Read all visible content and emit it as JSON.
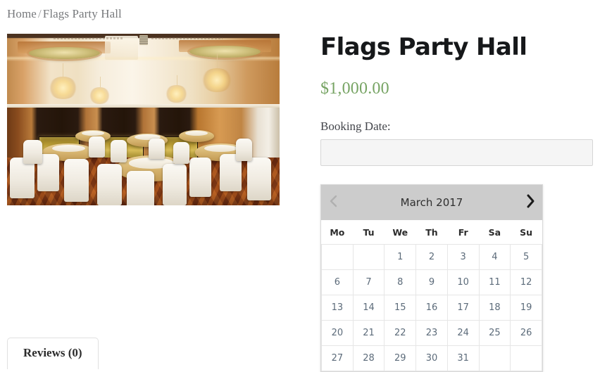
{
  "breadcrumb": {
    "home_label": "Home",
    "separator": "/",
    "current_label": "Flags Party Hall"
  },
  "product": {
    "title": "Flags Party Hall",
    "price": "$1,000.00",
    "image_alt": "Flags Party Hall banquet ballroom with round tables and chandeliers"
  },
  "booking": {
    "field_label": "Booking Date:",
    "input_value": "",
    "input_placeholder": ""
  },
  "datepicker": {
    "month_title": "March 2017",
    "prev_icon": "chevron-left-icon",
    "next_icon": "chevron-right-icon",
    "weekdays": [
      "Mo",
      "Tu",
      "We",
      "Th",
      "Fr",
      "Sa",
      "Su"
    ],
    "weeks": [
      [
        {
          "label": "",
          "state": "empty"
        },
        {
          "label": "",
          "state": "empty"
        },
        {
          "label": "1",
          "state": "other"
        },
        {
          "label": "2",
          "state": "other"
        },
        {
          "label": "3",
          "state": "other"
        },
        {
          "label": "4",
          "state": "today"
        },
        {
          "label": "5",
          "state": "weekend"
        }
      ],
      [
        {
          "label": "6",
          "state": "day"
        },
        {
          "label": "7",
          "state": "day"
        },
        {
          "label": "8",
          "state": "day"
        },
        {
          "label": "9",
          "state": "day"
        },
        {
          "label": "10",
          "state": "day"
        },
        {
          "label": "11",
          "state": "weekend"
        },
        {
          "label": "12",
          "state": "weekend"
        }
      ],
      [
        {
          "label": "13",
          "state": "day"
        },
        {
          "label": "14",
          "state": "day"
        },
        {
          "label": "15",
          "state": "day"
        },
        {
          "label": "16",
          "state": "day"
        },
        {
          "label": "17",
          "state": "day"
        },
        {
          "label": "18",
          "state": "weekend"
        },
        {
          "label": "19",
          "state": "weekend"
        }
      ],
      [
        {
          "label": "20",
          "state": "day"
        },
        {
          "label": "21",
          "state": "day"
        },
        {
          "label": "22",
          "state": "day"
        },
        {
          "label": "23",
          "state": "day"
        },
        {
          "label": "24",
          "state": "day"
        },
        {
          "label": "25",
          "state": "weekend"
        },
        {
          "label": "26",
          "state": "weekend"
        }
      ],
      [
        {
          "label": "27",
          "state": "day"
        },
        {
          "label": "28",
          "state": "day"
        },
        {
          "label": "29",
          "state": "day"
        },
        {
          "label": "30",
          "state": "day"
        },
        {
          "label": "31",
          "state": "day"
        },
        {
          "label": "",
          "state": "empty"
        },
        {
          "label": "",
          "state": "empty"
        }
      ]
    ]
  },
  "tabs": [
    {
      "label": "Reviews (0)",
      "name": "tab-reviews",
      "active": true
    }
  ],
  "colors": {
    "price_green": "#77a464",
    "breadcrumb_gray": "#77797c",
    "datepicker_header": "#cccccc",
    "today_highlight": "#fdf8e3",
    "day_cell": "#ededed"
  }
}
